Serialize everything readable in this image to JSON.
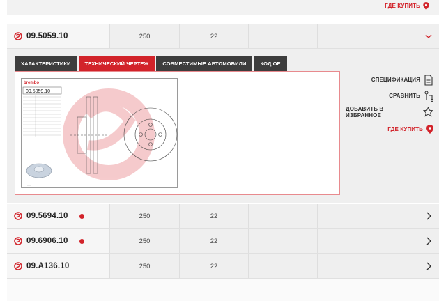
{
  "top": {
    "where_to_buy": "ГДЕ КУПИТЬ"
  },
  "rows": [
    {
      "part": "09.5059.10",
      "d": "250",
      "t": "22",
      "dot": false
    },
    {
      "part": "09.5694.10",
      "d": "250",
      "t": "22",
      "dot": true
    },
    {
      "part": "09.6906.10",
      "d": "250",
      "t": "22",
      "dot": true
    },
    {
      "part": "09.A136.10",
      "d": "250",
      "t": "22",
      "dot": false
    }
  ],
  "tabs": [
    {
      "label": "ХАРАКТЕРИСТИКИ"
    },
    {
      "label": "ТЕХНИЧЕСКИЙ ЧЕРТЕЖ"
    },
    {
      "label": "СОВМЕСТИМЫЕ АВТОМОБИЛИ"
    },
    {
      "label": "КОД ОЕ"
    }
  ],
  "drawing": {
    "part": "09.5059.10",
    "brand": "brembo"
  },
  "actions": {
    "spec": "СПЕЦИФИКАЦИЯ",
    "compare": "СРАВНИТЬ",
    "favorite": "ДОБАВИТЬ В ИЗБРАННОЕ",
    "where": "ГДЕ КУПИТЬ"
  },
  "colors": {
    "accent": "#d2232a",
    "tab_dark": "#3d3d3d",
    "row_bg": "#efefef"
  }
}
